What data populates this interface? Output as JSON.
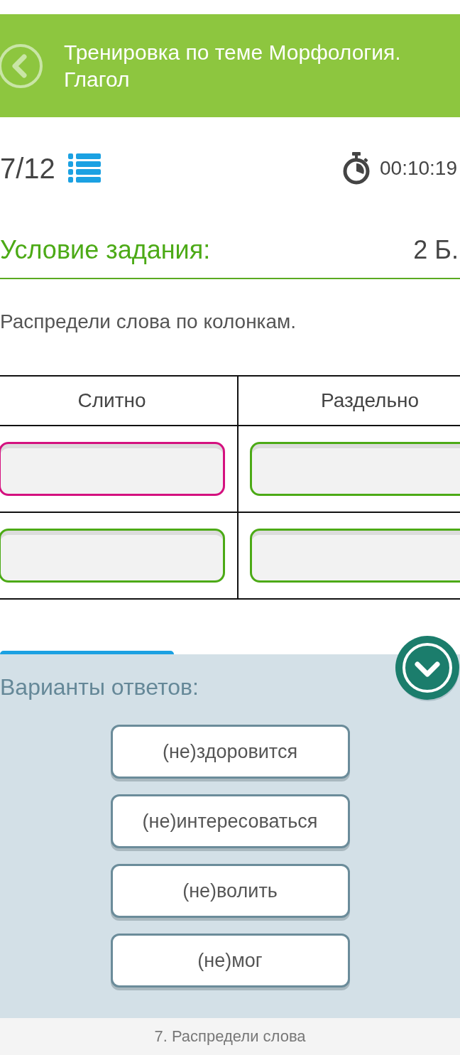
{
  "header": {
    "title": "Тренировка по теме Морфология. Глагол"
  },
  "progress": {
    "counter": "7/12",
    "timer": "00:10:19"
  },
  "task": {
    "heading": "Условие задания:",
    "points": "2 Б.",
    "instruction": "Распредели слова по колонкам."
  },
  "table": {
    "columns": [
      "Слитно",
      "Раздельно"
    ],
    "rows": [
      [
        {
          "color": "#d4117f"
        },
        {
          "color": "#4caa16"
        }
      ],
      [
        {
          "color": "#4caa16"
        },
        {
          "color": "#4caa16"
        }
      ]
    ]
  },
  "answers": {
    "heading": "Варианты ответов:",
    "options": [
      "(не)здоровится",
      "(не)интересоваться",
      "(не)волить",
      "(не)мог"
    ]
  },
  "footer": {
    "caption": "7. Распредели слова"
  }
}
